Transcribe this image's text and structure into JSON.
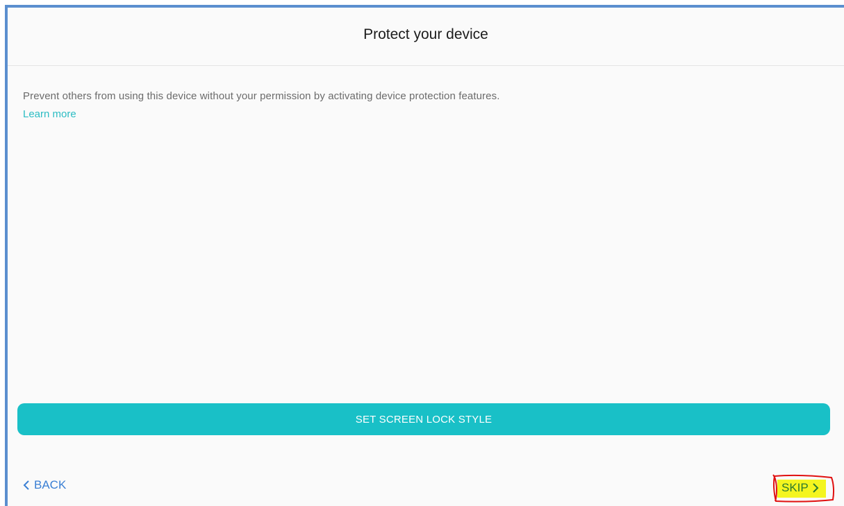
{
  "header": {
    "title": "Protect your device"
  },
  "main": {
    "description": "Prevent others from using this device without your permission by activating device protection features.",
    "learn_more": "Learn more",
    "primary_button": "SET SCREEN LOCK STYLE"
  },
  "footer": {
    "back_label": "BACK",
    "skip_label": "SKIP",
    "back_icon": "chevron-left-icon",
    "skip_icon": "chevron-right-icon"
  },
  "colors": {
    "accent": "#19c0c7",
    "link": "#2bbcc3",
    "nav_link": "#3a7fd4",
    "highlight": "#f4f51f",
    "annotation": "#e01010",
    "frame_border": "#5b8fcf"
  }
}
